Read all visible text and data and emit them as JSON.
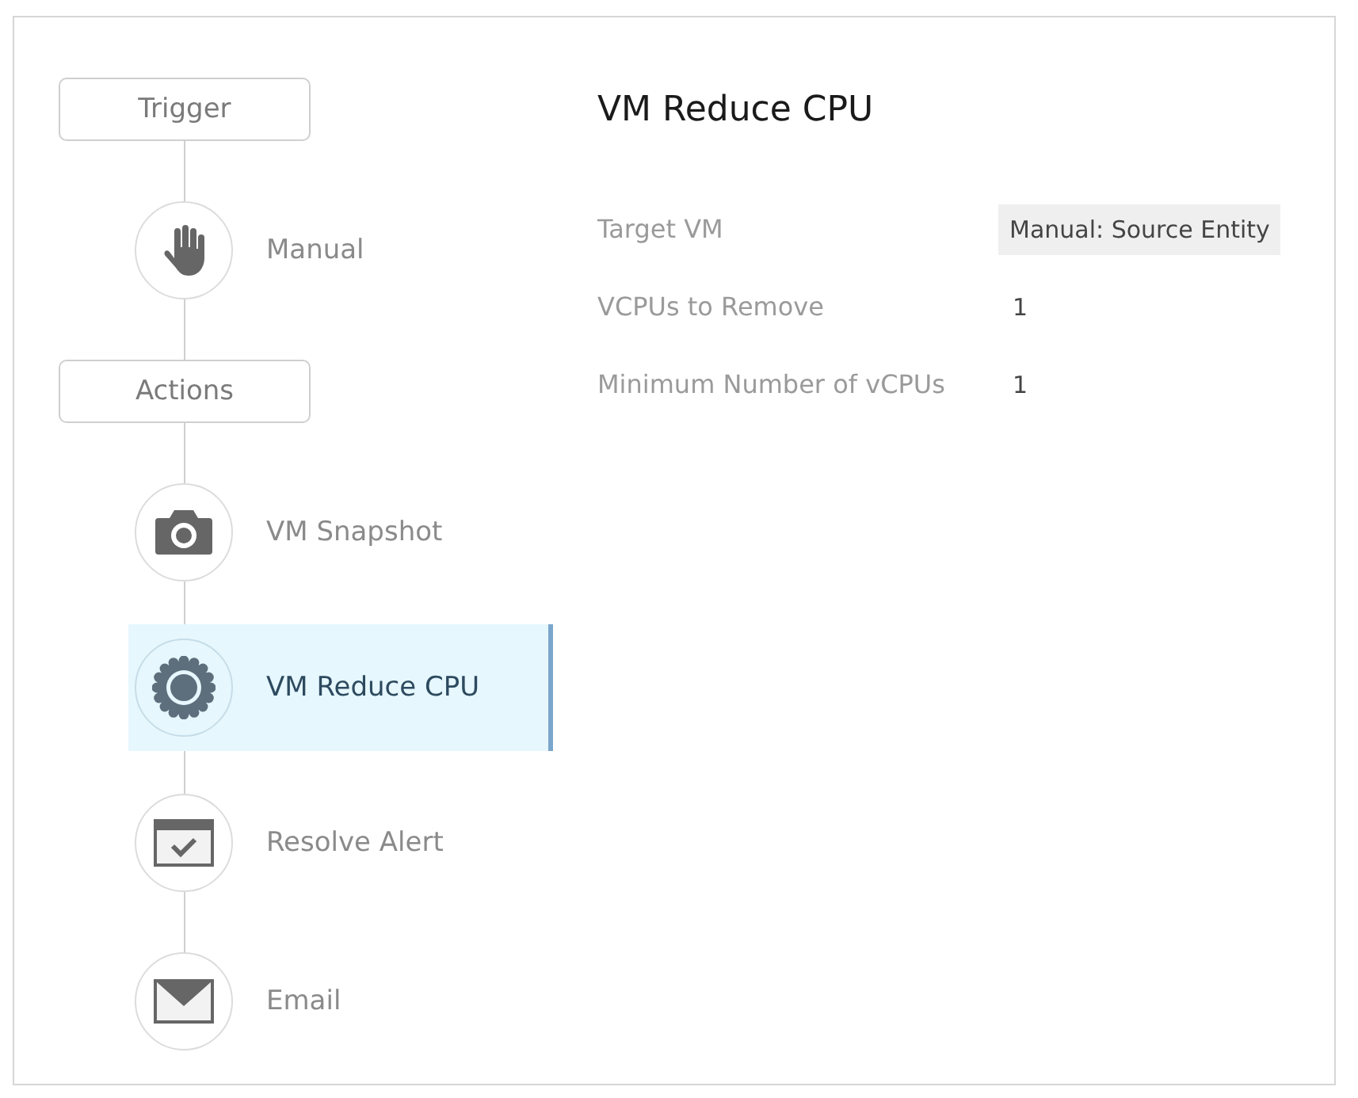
{
  "flow": [
    {
      "kind": "stage",
      "label": "Trigger"
    },
    {
      "kind": "step",
      "label": "Manual",
      "selected": false
    },
    {
      "kind": "stage",
      "label": "Actions"
    },
    {
      "kind": "step",
      "label": "VM Snapshot",
      "selected": false
    },
    {
      "kind": "step",
      "label": "VM Reduce CPU",
      "selected": true
    },
    {
      "kind": "step",
      "label": "Resolve Alert",
      "selected": false
    },
    {
      "kind": "step",
      "label": "Email",
      "selected": false
    }
  ],
  "details": {
    "title": "VM Reduce CPU",
    "fields": [
      {
        "label": "Target VM",
        "value": "Manual:  Source Entity",
        "shaded": true
      },
      {
        "label": "VCPUs to Remove",
        "value": "1",
        "shaded": false
      },
      {
        "label": "Minimum Number of vCPUs",
        "value": "1",
        "shaded": false
      }
    ]
  }
}
